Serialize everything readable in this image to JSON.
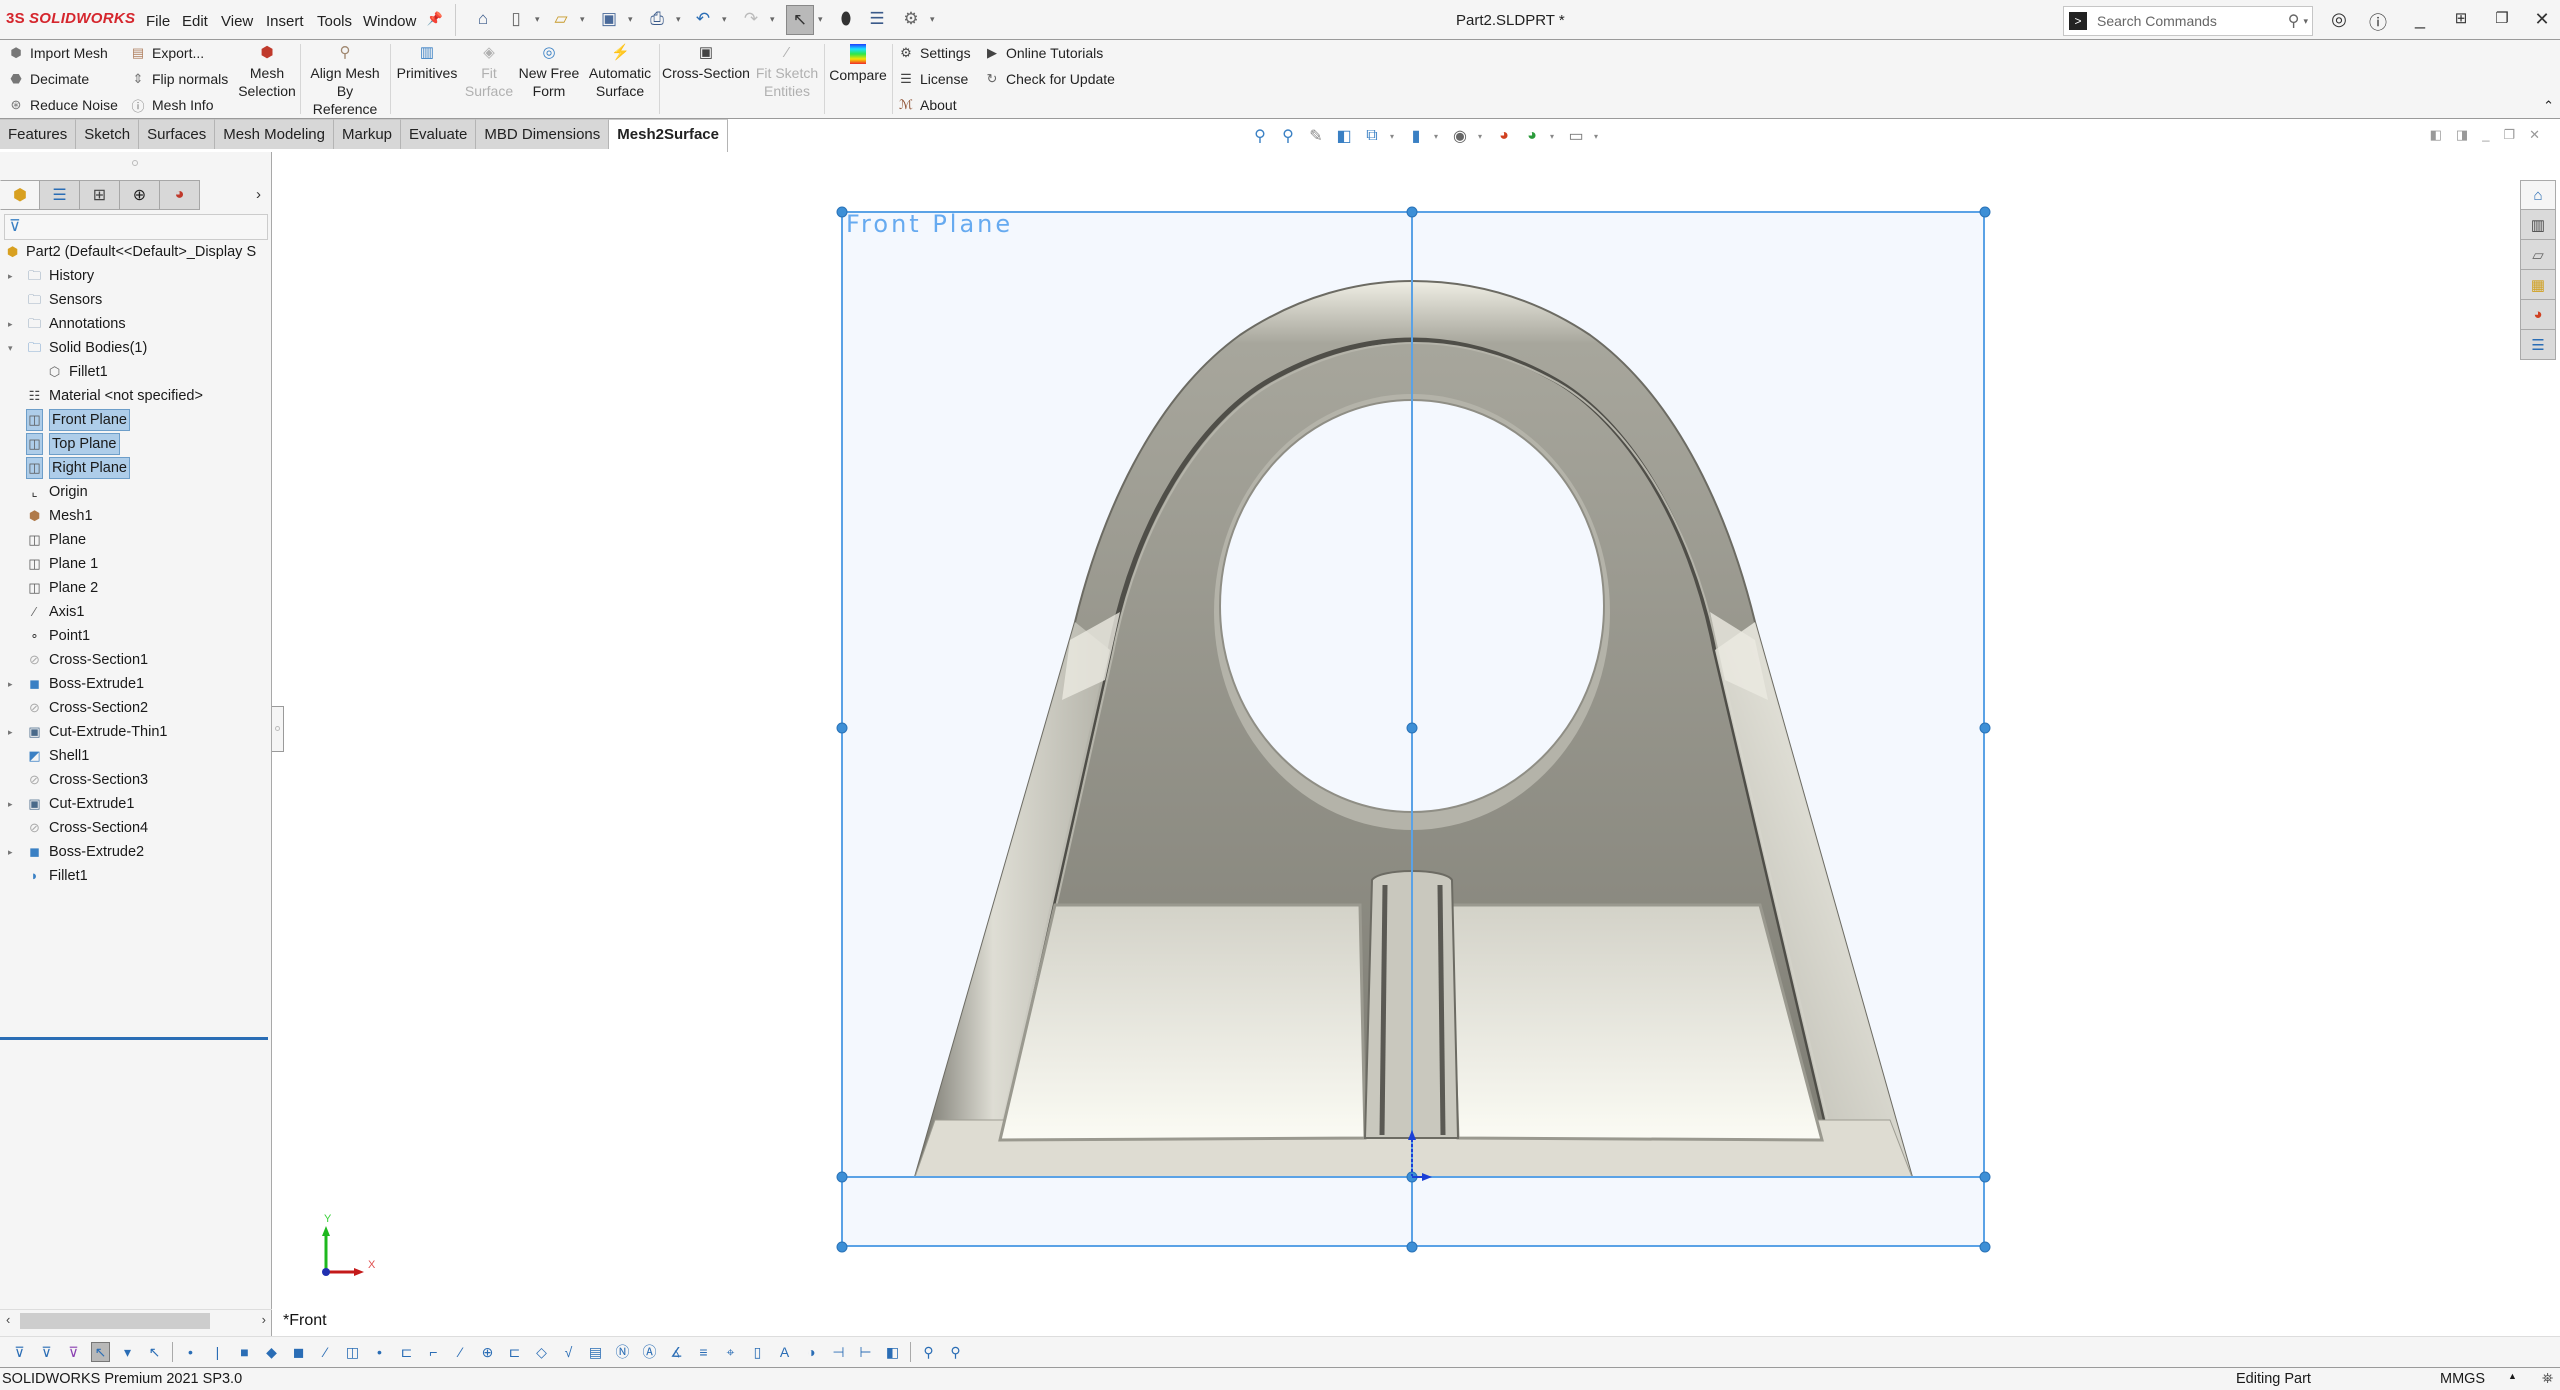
{
  "app": {
    "logo_text": "SOLIDWORKS",
    "logo_mark": "3S",
    "document_title": "Part2.SLDPRT *",
    "menu": [
      "File",
      "Edit",
      "View",
      "Insert",
      "Tools",
      "Window"
    ],
    "search": {
      "placeholder": "Search Commands"
    },
    "quick_access_icons": [
      "home-icon",
      "new-document-icon",
      "open-icon",
      "save-icon",
      "print-icon",
      "undo-icon",
      "redo-icon",
      "select-icon",
      "rebuild-icon",
      "file-properties-icon",
      "options-gear-icon"
    ],
    "window_controls": [
      "user-account-icon",
      "help-icon",
      "minimize-icon",
      "tile-icon",
      "restore-icon",
      "close-icon"
    ]
  },
  "ribbon": {
    "small_group_1": [
      {
        "label": "Import Mesh",
        "icon": "import-mesh-icon"
      },
      {
        "label": "Decimate",
        "icon": "decimate-icon"
      },
      {
        "label": "Reduce Noise",
        "icon": "reduce-noise-icon"
      }
    ],
    "small_group_2": [
      {
        "label": "Export...",
        "icon": "export-icon"
      },
      {
        "label": "Flip normals",
        "icon": "flip-normals-icon"
      },
      {
        "label": "Mesh Info",
        "icon": "mesh-info-icon"
      }
    ],
    "big_buttons": [
      {
        "line1": "Mesh",
        "line2": "Selection",
        "disabled": false
      },
      {
        "line1": "Align Mesh",
        "line2": "By Reference",
        "disabled": false
      },
      {
        "line1": "Primitives",
        "line2": "",
        "disabled": false
      },
      {
        "line1": "Fit",
        "line2": "Surface",
        "disabled": true
      },
      {
        "line1": "New Free",
        "line2": "Form",
        "disabled": false
      },
      {
        "line1": "Automatic",
        "line2": "Surface",
        "disabled": false
      },
      {
        "line1": "Cross-Section",
        "line2": "",
        "disabled": false
      },
      {
        "line1": "Fit Sketch",
        "line2": "Entities",
        "disabled": true
      },
      {
        "line1": "Compare",
        "line2": "",
        "disabled": false
      }
    ],
    "small_group_3": [
      {
        "label": "Settings",
        "icon": "settings-gear-icon"
      },
      {
        "label": "License",
        "icon": "license-icon"
      },
      {
        "label": "About",
        "icon": "about-icon"
      }
    ],
    "small_group_4": [
      {
        "label": "Online Tutorials",
        "icon": "tutorial-play-icon"
      },
      {
        "label": "Check for Update",
        "icon": "refresh-icon"
      }
    ]
  },
  "tabs": [
    {
      "label": "Features",
      "active": false
    },
    {
      "label": "Sketch",
      "active": false
    },
    {
      "label": "Surfaces",
      "active": false
    },
    {
      "label": "Mesh Modeling",
      "active": false
    },
    {
      "label": "Markup",
      "active": false
    },
    {
      "label": "Evaluate",
      "active": false
    },
    {
      "label": "MBD Dimensions",
      "active": false
    },
    {
      "label": "Mesh2Surface",
      "active": true
    }
  ],
  "feature_tree": {
    "root": "Part2  (Default<<Default>_Display S",
    "items": [
      {
        "label": "History",
        "icon": "history-folder-icon",
        "expand": "collapsed",
        "indent": 0,
        "selected": false
      },
      {
        "label": "Sensors",
        "icon": "sensors-folder-icon",
        "expand": "none",
        "indent": 0,
        "selected": false
      },
      {
        "label": "Annotations",
        "icon": "annotations-folder-icon",
        "expand": "collapsed",
        "indent": 0,
        "selected": false
      },
      {
        "label": "Solid Bodies(1)",
        "icon": "solid-bodies-folder-icon",
        "expand": "expanded",
        "indent": 0,
        "selected": false
      },
      {
        "label": "Fillet1",
        "icon": "solid-body-icon",
        "expand": "none",
        "indent": 1,
        "selected": false
      },
      {
        "label": "Material <not specified>",
        "icon": "material-icon",
        "expand": "none",
        "indent": 0,
        "selected": false
      },
      {
        "label": "Front Plane",
        "icon": "plane-icon",
        "expand": "none",
        "indent": 0,
        "selected": true
      },
      {
        "label": "Top Plane",
        "icon": "plane-icon",
        "expand": "none",
        "indent": 0,
        "selected": true
      },
      {
        "label": "Right Plane",
        "icon": "plane-icon",
        "expand": "none",
        "indent": 0,
        "selected": true
      },
      {
        "label": "Origin",
        "icon": "origin-icon",
        "expand": "none",
        "indent": 0,
        "selected": false
      },
      {
        "label": "Mesh1",
        "icon": "mesh-icon",
        "expand": "none",
        "indent": 0,
        "selected": false
      },
      {
        "label": "Plane",
        "icon": "plane-icon",
        "expand": "none",
        "indent": 0,
        "selected": false
      },
      {
        "label": "Plane 1",
        "icon": "plane-icon",
        "expand": "none",
        "indent": 0,
        "selected": false
      },
      {
        "label": "Plane 2",
        "icon": "plane-icon",
        "expand": "none",
        "indent": 0,
        "selected": false
      },
      {
        "label": "Axis1",
        "icon": "axis-icon",
        "expand": "none",
        "indent": 0,
        "selected": false
      },
      {
        "label": "Point1",
        "icon": "point-icon",
        "expand": "none",
        "indent": 0,
        "selected": false
      },
      {
        "label": "Cross-Section1",
        "icon": "cross-section-icon",
        "expand": "none",
        "indent": 0,
        "selected": false
      },
      {
        "label": "Boss-Extrude1",
        "icon": "boss-extrude-icon",
        "expand": "collapsed",
        "indent": 0,
        "selected": false
      },
      {
        "label": "Cross-Section2",
        "icon": "cross-section-icon",
        "expand": "none",
        "indent": 0,
        "selected": false
      },
      {
        "label": "Cut-Extrude-Thin1",
        "icon": "cut-extrude-icon",
        "expand": "collapsed",
        "indent": 0,
        "selected": false
      },
      {
        "label": "Shell1",
        "icon": "shell-icon",
        "expand": "none",
        "indent": 0,
        "selected": false
      },
      {
        "label": "Cross-Section3",
        "icon": "cross-section-icon",
        "expand": "none",
        "indent": 0,
        "selected": false
      },
      {
        "label": "Cut-Extrude1",
        "icon": "cut-extrude-icon",
        "expand": "collapsed",
        "indent": 0,
        "selected": false
      },
      {
        "label": "Cross-Section4",
        "icon": "cross-section-icon",
        "expand": "none",
        "indent": 0,
        "selected": false
      },
      {
        "label": "Boss-Extrude2",
        "icon": "boss-extrude-icon",
        "expand": "collapsed",
        "indent": 0,
        "selected": false
      },
      {
        "label": "Fillet1",
        "icon": "fillet-icon",
        "expand": "none",
        "indent": 0,
        "selected": false
      }
    ]
  },
  "viewport": {
    "plane_label": "Front Plane",
    "view_name": "*Front",
    "triad": {
      "x_label": "X",
      "y_label": "Y"
    },
    "colors": {
      "plane_border": "#5aa2e6",
      "plane_fill": "#f4f8fe",
      "plane_label": "#66aaf0",
      "part_dark": "#7e7d74",
      "part_light": "#f0efe6"
    }
  },
  "status": {
    "product": "SOLIDWORKS Premium 2021 SP3.0",
    "mode": "Editing Part",
    "units": "MMGS"
  }
}
